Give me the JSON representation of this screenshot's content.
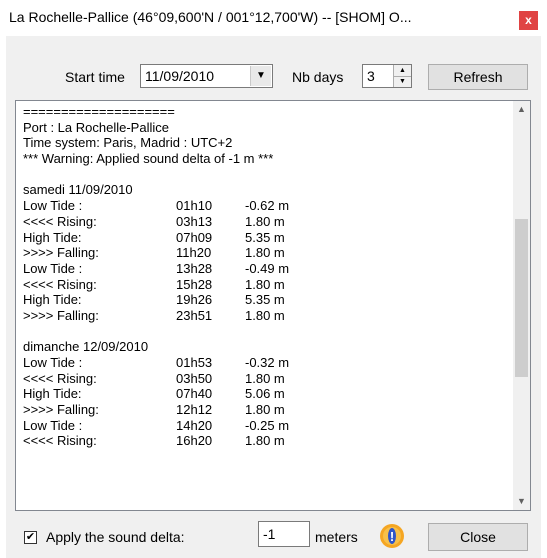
{
  "window": {
    "title": "La Rochelle-Pallice (46°09,600'N / 001°12,700'W) -- [SHOM] O...",
    "close_glyph": "x"
  },
  "toolbar": {
    "start_time_label": "Start time",
    "start_time_value": "11/09/2010",
    "nb_days_label": "Nb days",
    "nb_days_value": "3",
    "refresh_label": "Refresh"
  },
  "report": {
    "lines": [
      {
        "a": "====================",
        "b": "",
        "c": ""
      },
      {
        "a": "Port : La Rochelle-Pallice",
        "b": "",
        "c": ""
      },
      {
        "a": "Time system: Paris, Madrid : UTC+2",
        "b": "",
        "c": ""
      },
      {
        "a": "*** Warning: Applied sound delta of -1 m ***",
        "b": "",
        "c": ""
      },
      {
        "a": "",
        "b": "",
        "c": ""
      },
      {
        "a": "samedi 11/09/2010",
        "b": "",
        "c": ""
      },
      {
        "a": "Low Tide :",
        "b": "01h10",
        "c": "-0.62 m"
      },
      {
        "a": "<<<< Rising:",
        "b": "03h13",
        "c": "1.80 m"
      },
      {
        "a": "High Tide:",
        "b": "07h09",
        "c": "5.35 m"
      },
      {
        "a": ">>>> Falling:",
        "b": "11h20",
        "c": "1.80 m"
      },
      {
        "a": "Low Tide :",
        "b": "13h28",
        "c": "-0.49 m"
      },
      {
        "a": "<<<< Rising:",
        "b": "15h28",
        "c": "1.80 m"
      },
      {
        "a": "High Tide:",
        "b": "19h26",
        "c": "5.35 m"
      },
      {
        "a": ">>>> Falling:",
        "b": "23h51",
        "c": "1.80 m"
      },
      {
        "a": "",
        "b": "",
        "c": ""
      },
      {
        "a": "dimanche 12/09/2010",
        "b": "",
        "c": ""
      },
      {
        "a": "Low Tide :",
        "b": "01h53",
        "c": "-0.32 m"
      },
      {
        "a": "<<<< Rising:",
        "b": "03h50",
        "c": "1.80 m"
      },
      {
        "a": "High Tide:",
        "b": "07h40",
        "c": "5.06 m"
      },
      {
        "a": ">>>> Falling:",
        "b": "12h12",
        "c": "1.80 m"
      },
      {
        "a": "Low Tide :",
        "b": "14h20",
        "c": "-0.25 m"
      },
      {
        "a": "<<<< Rising:",
        "b": "16h20",
        "c": "1.80 m"
      }
    ]
  },
  "footer": {
    "apply_delta_label": "Apply the sound delta:",
    "apply_delta_checked": true,
    "delta_value": "-1",
    "units_label": "meters",
    "close_label": "Close"
  },
  "icons": {
    "combo_arrow": "▼",
    "spin_up": "▲",
    "spin_down": "▼",
    "scroll_up": "▲",
    "scroll_down": "▼",
    "check": "✔",
    "info": "!"
  },
  "colors": {
    "title_close_bg": "#e04343",
    "info_badge_outer": "#f5a623",
    "info_badge_inner": "#2f55c9"
  }
}
